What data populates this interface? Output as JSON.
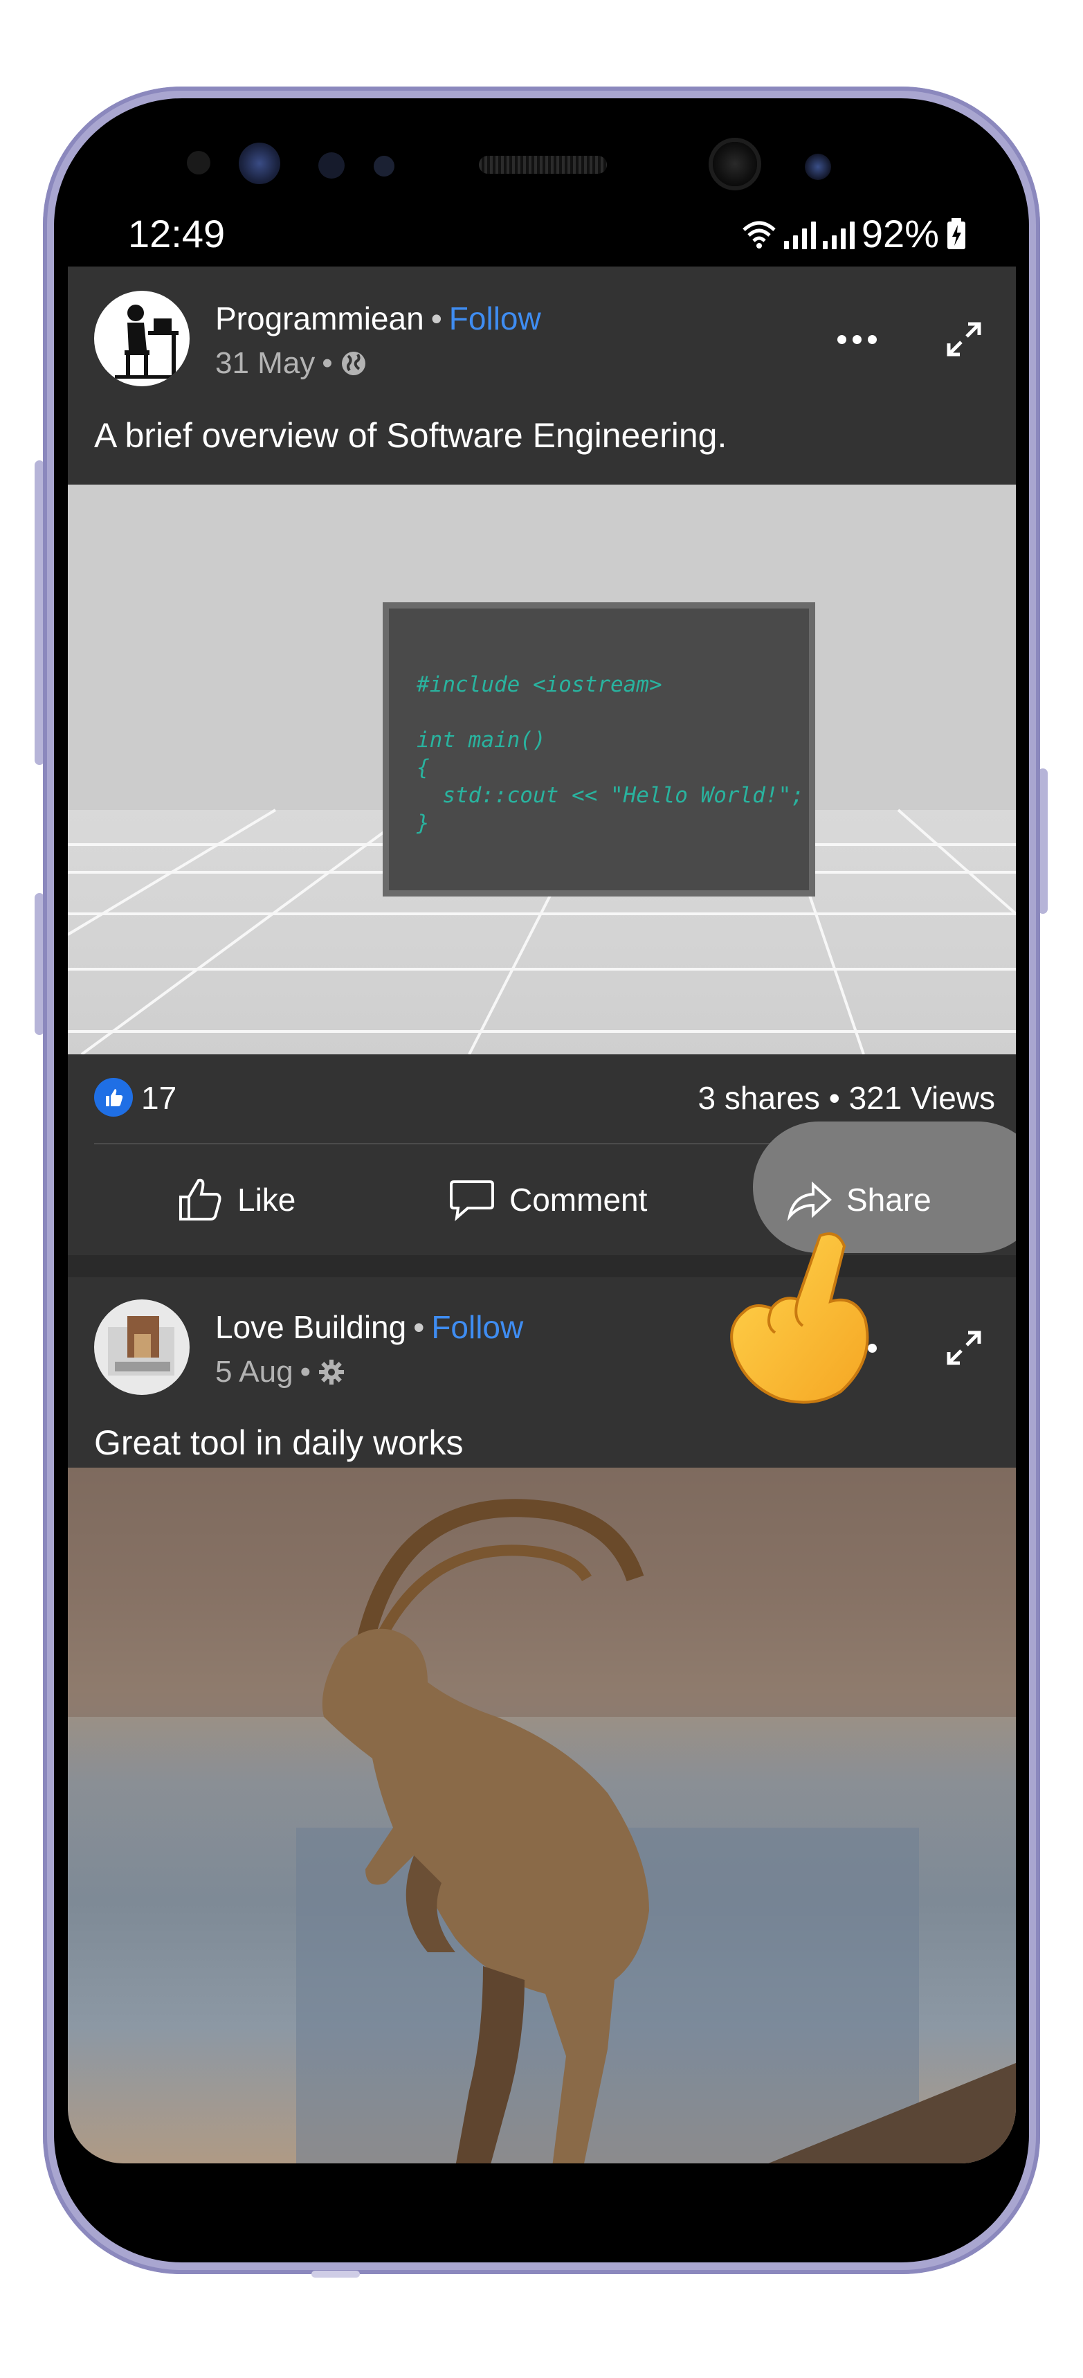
{
  "status_bar": {
    "time": "12:49",
    "battery": "92%"
  },
  "posts": [
    {
      "author": "Programmiean",
      "follow_label": "Follow",
      "date": "31 May",
      "text": "A brief overview of Software Engineering.",
      "code_lines": [
        "#include <iostream>",
        "",
        "int main()",
        "{",
        "  std::cout << \"Hello World!\";",
        "}"
      ],
      "likes": "17",
      "shares_views": "3 shares • 321 Views",
      "actions": {
        "like": "Like",
        "comment": "Comment",
        "share": "Share"
      }
    },
    {
      "author": "Love Building",
      "follow_label": "Follow",
      "date": "5 Aug",
      "text": "Great tool in daily works"
    }
  ],
  "icons": {
    "privacy_public": "globe-icon",
    "privacy_custom": "gear-icon",
    "tap_gesture": "pointing-hand-icon"
  },
  "colors": {
    "follow": "#3f8df2",
    "like_badge": "#1f6fe5",
    "screen_bg": "#333333"
  }
}
